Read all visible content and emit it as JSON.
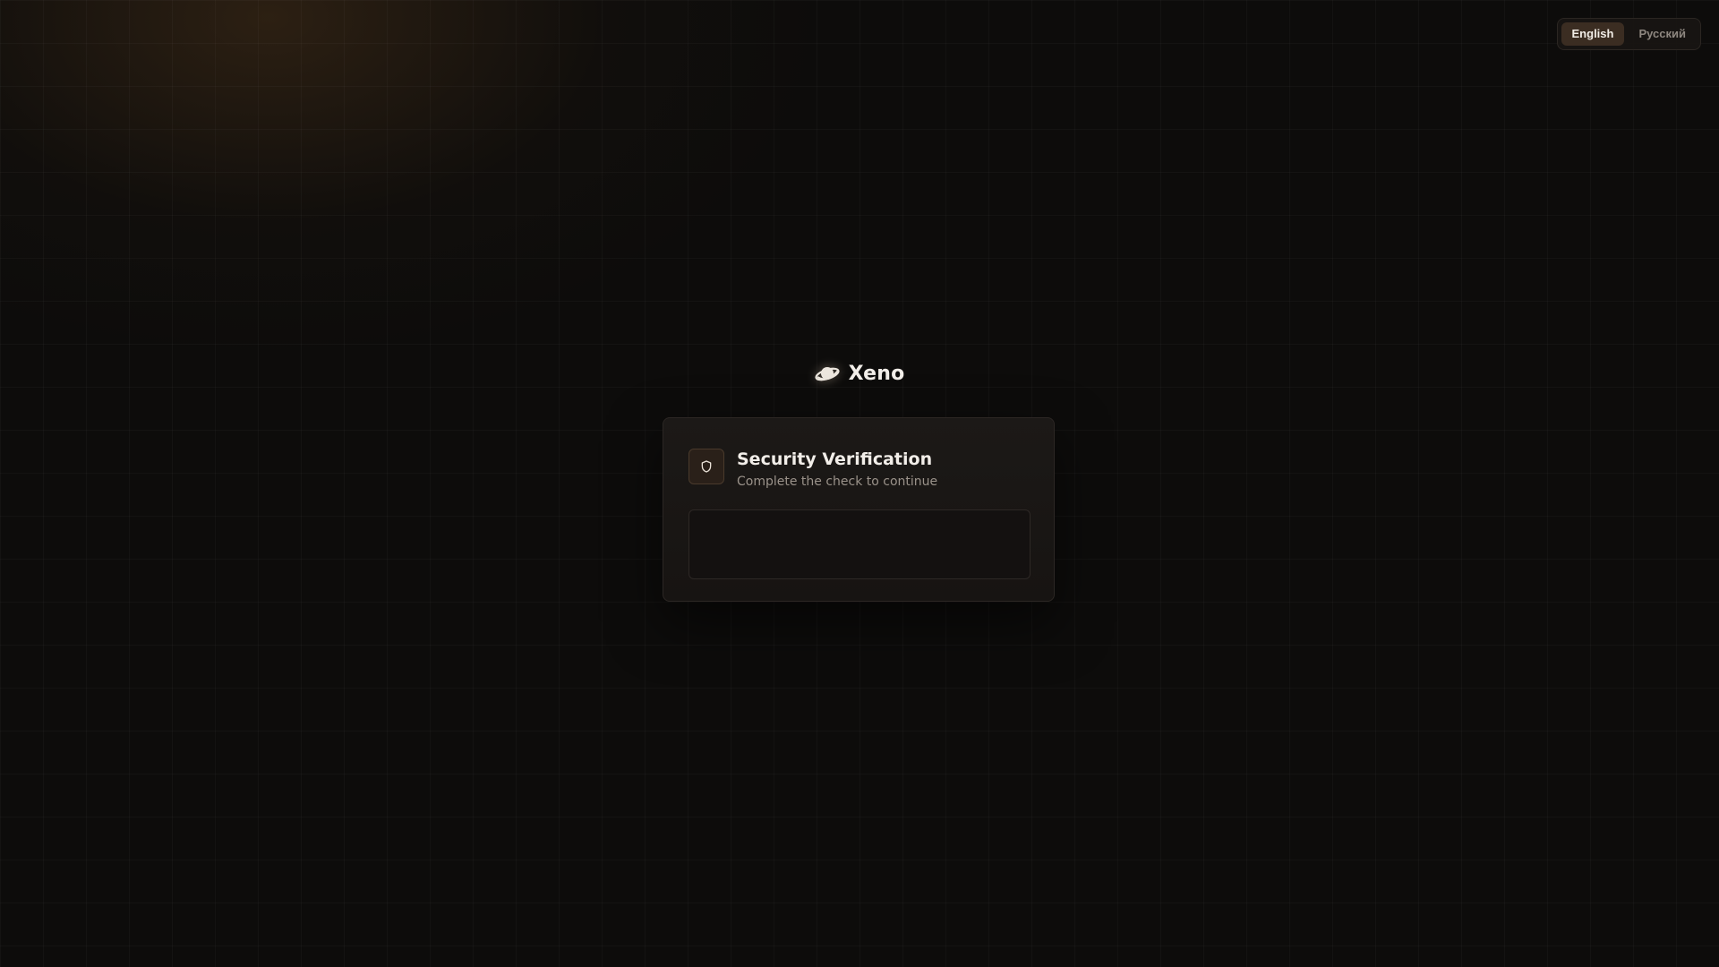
{
  "language_switch": {
    "options": [
      {
        "label": "English",
        "active": true
      },
      {
        "label": "Русский",
        "active": false
      }
    ]
  },
  "brand": {
    "name": "Xeno",
    "icon": "planet-icon"
  },
  "verification": {
    "title": "Security Verification",
    "subtitle": "Complete the check to continue",
    "icon": "shield-icon"
  },
  "colors": {
    "background": "#0d0c0b",
    "accent": "#3b2d22",
    "text_primary": "#f2eee9",
    "text_secondary": "#9a928a"
  }
}
